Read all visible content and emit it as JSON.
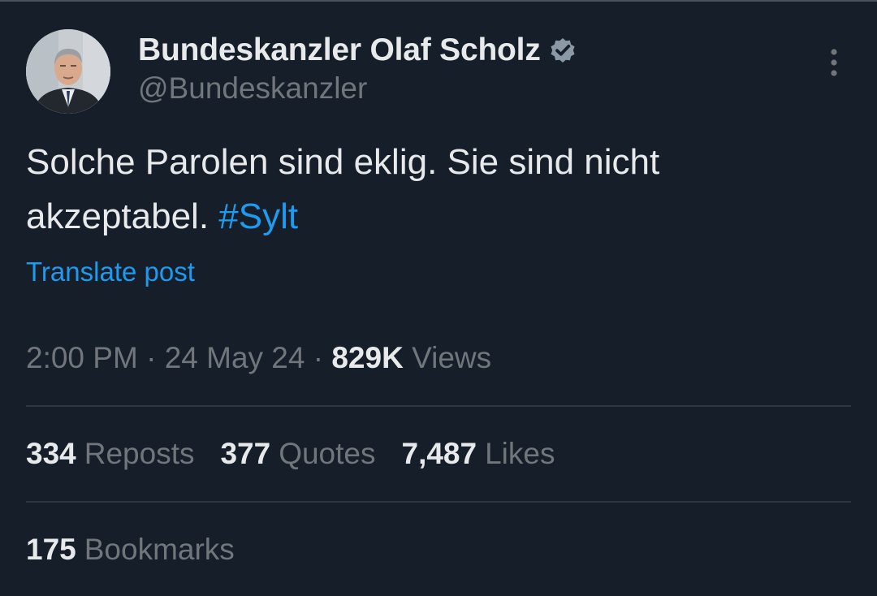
{
  "author": {
    "display_name": "Bundeskanzler Olaf Scholz",
    "handle": "@Bundeskanzler",
    "verified_icon": "verified-badge-icon",
    "avatar_icon": "profile-photo"
  },
  "post": {
    "text": "Solche Parolen sind eklig. Sie sind nicht akzeptabel.",
    "hashtag": "#Sylt",
    "translate_label": "Translate post"
  },
  "meta": {
    "time": "2:00 PM",
    "separator": "·",
    "date": "24 May 24",
    "views_count": "829K",
    "views_label": "Views"
  },
  "stats": {
    "reposts_count": "334",
    "reposts_label": "Reposts",
    "quotes_count": "377",
    "quotes_label": "Quotes",
    "likes_count": "7,487",
    "likes_label": "Likes",
    "bookmarks_count": "175",
    "bookmarks_label": "Bookmarks"
  },
  "colors": {
    "background": "#161e29",
    "text_primary": "#e7e9ea",
    "text_secondary": "#71767b",
    "accent": "#1d9bf0"
  }
}
